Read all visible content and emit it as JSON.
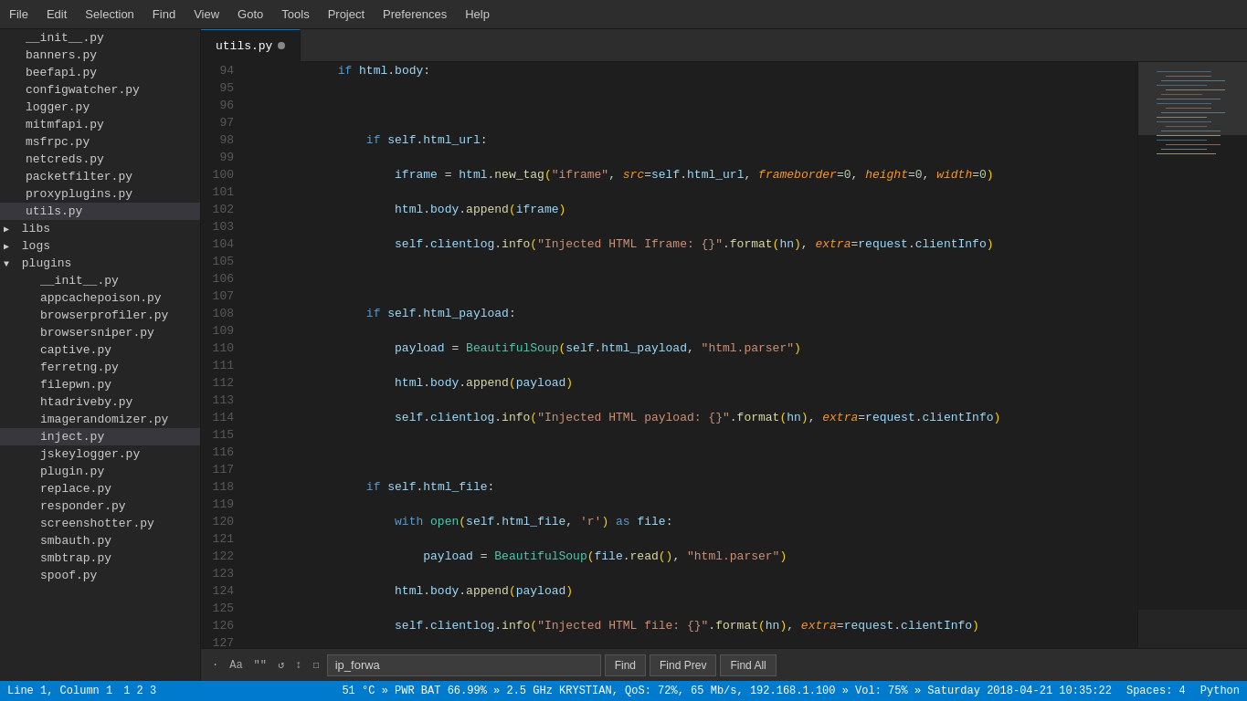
{
  "menubar": {
    "items": [
      "File",
      "Edit",
      "Selection",
      "Find",
      "View",
      "Goto",
      "Tools",
      "Project",
      "Preferences",
      "Help"
    ]
  },
  "tab": {
    "label": "utils.py",
    "modified": true
  },
  "sidebar": {
    "files": [
      {
        "label": "__init__.py",
        "indent": 1,
        "type": "file"
      },
      {
        "label": "banners.py",
        "indent": 1,
        "type": "file"
      },
      {
        "label": "beefapi.py",
        "indent": 1,
        "type": "file"
      },
      {
        "label": "configwatcher.py",
        "indent": 1,
        "type": "file"
      },
      {
        "label": "logger.py",
        "indent": 1,
        "type": "file"
      },
      {
        "label": "mitmfapi.py",
        "indent": 1,
        "type": "file"
      },
      {
        "label": "msfrpc.py",
        "indent": 1,
        "type": "file"
      },
      {
        "label": "netcreds.py",
        "indent": 1,
        "type": "file"
      },
      {
        "label": "packetfilter.py",
        "indent": 1,
        "type": "file"
      },
      {
        "label": "proxyplugins.py",
        "indent": 1,
        "type": "file"
      },
      {
        "label": "utils.py",
        "indent": 1,
        "type": "file",
        "active": true
      },
      {
        "label": "libs",
        "indent": 0,
        "type": "folder-closed"
      },
      {
        "label": "logs",
        "indent": 0,
        "type": "folder-closed"
      },
      {
        "label": "plugins",
        "indent": 0,
        "type": "folder-open"
      },
      {
        "label": "__init__.py",
        "indent": 2,
        "type": "file"
      },
      {
        "label": "appcachepoison.py",
        "indent": 2,
        "type": "file"
      },
      {
        "label": "browserprofiler.py",
        "indent": 2,
        "type": "file"
      },
      {
        "label": "browsersniper.py",
        "indent": 2,
        "type": "file"
      },
      {
        "label": "captive.py",
        "indent": 2,
        "type": "file"
      },
      {
        "label": "ferretng.py",
        "indent": 2,
        "type": "file"
      },
      {
        "label": "filepwn.py",
        "indent": 2,
        "type": "file"
      },
      {
        "label": "htadriveby.py",
        "indent": 2,
        "type": "file"
      },
      {
        "label": "imagerandomizer.py",
        "indent": 2,
        "type": "file"
      },
      {
        "label": "inject.py",
        "indent": 2,
        "type": "file",
        "active": true
      },
      {
        "label": "jskeylogger.py",
        "indent": 2,
        "type": "file"
      },
      {
        "label": "plugin.py",
        "indent": 2,
        "type": "file"
      },
      {
        "label": "replace.py",
        "indent": 2,
        "type": "file"
      },
      {
        "label": "responder.py",
        "indent": 2,
        "type": "file"
      },
      {
        "label": "screenshotter.py",
        "indent": 2,
        "type": "file"
      },
      {
        "label": "smbauth.py",
        "indent": 2,
        "type": "file"
      },
      {
        "label": "smbtrap.py",
        "indent": 2,
        "type": "file"
      },
      {
        "label": "spoof.py",
        "indent": 2,
        "type": "file"
      }
    ]
  },
  "find_bar": {
    "icons": [
      ".*",
      "Aa",
      "\"\"",
      "loop",
      "wrap",
      "box"
    ],
    "input_value": "ip_forwa",
    "find_label": "Find",
    "find_prev_label": "Find Prev",
    "find_all_label": "Find All"
  },
  "status_bar": {
    "line_col": "Line 1, Column 1",
    "branch": "1  2  3",
    "system_info": "51 °C » PWR BAT 66.99% » 2.5 GHz  KRYSTIAN, QoS: 72%, 65 Mb/s, 192.168.1.100 » Vol: 75% »  Saturday 2018-04-21 10:35:22",
    "spaces": "Spaces: 4",
    "language": "Python"
  }
}
